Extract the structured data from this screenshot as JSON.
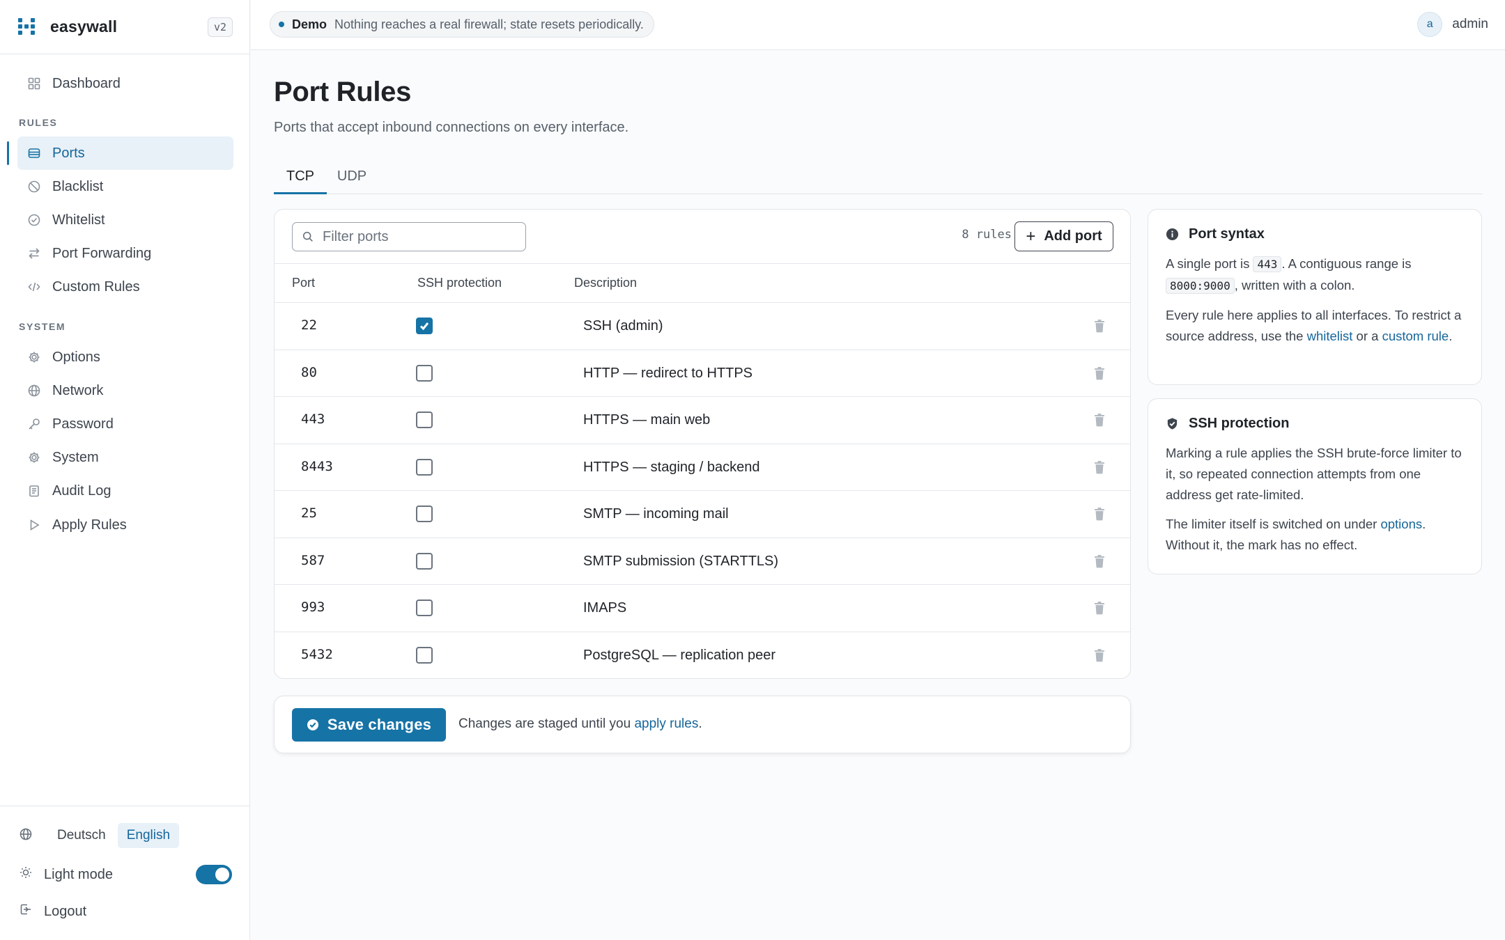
{
  "app": {
    "name": "easywall",
    "version": "v2"
  },
  "sidebar": {
    "dashboard": "Dashboard",
    "rules_label": "RULES",
    "rules": [
      {
        "label": "Ports",
        "icon": "ports-icon"
      },
      {
        "label": "Blacklist",
        "icon": "ban-icon"
      },
      {
        "label": "Whitelist",
        "icon": "check-circle-icon"
      },
      {
        "label": "Port Forwarding",
        "icon": "arrows-icon"
      },
      {
        "label": "Custom Rules",
        "icon": "code-icon"
      }
    ],
    "system_label": "SYSTEM",
    "system": [
      {
        "label": "Options",
        "icon": "gear-icon"
      },
      {
        "label": "Network",
        "icon": "globe-icon"
      },
      {
        "label": "Password",
        "icon": "key-icon"
      },
      {
        "label": "System",
        "icon": "gear-icon"
      },
      {
        "label": "Audit Log",
        "icon": "log-icon"
      },
      {
        "label": "Apply Rules",
        "icon": "play-icon"
      }
    ],
    "languages": [
      "Deutsch",
      "English"
    ],
    "selected_language": "English",
    "light_mode": "Light mode",
    "light_mode_on": true,
    "logout": "Logout"
  },
  "topbar": {
    "demo_label": "Demo",
    "demo_text": "Nothing reaches a real firewall; state resets periodically.",
    "avatar_letter": "a",
    "username": "admin"
  },
  "page": {
    "title": "Port Rules",
    "subtitle": "Ports that accept inbound connections on every interface.",
    "tabs": [
      "TCP",
      "UDP"
    ],
    "active_tab": "TCP"
  },
  "table": {
    "filter_placeholder": "Filter ports",
    "rule_count": "8 rules",
    "add_label": "Add port",
    "columns": [
      "Port",
      "SSH protection",
      "Description"
    ],
    "rows": [
      {
        "port": "22",
        "ssh": true,
        "description": "SSH (admin)"
      },
      {
        "port": "80",
        "ssh": false,
        "description": "HTTP — redirect to HTTPS"
      },
      {
        "port": "443",
        "ssh": false,
        "description": "HTTPS — main web"
      },
      {
        "port": "8443",
        "ssh": false,
        "description": "HTTPS — staging / backend"
      },
      {
        "port": "25",
        "ssh": false,
        "description": "SMTP — incoming mail"
      },
      {
        "port": "587",
        "ssh": false,
        "description": "SMTP submission (STARTTLS)"
      },
      {
        "port": "993",
        "ssh": false,
        "description": "IMAPS"
      },
      {
        "port": "5432",
        "ssh": false,
        "description": "PostgreSQL — replication peer"
      }
    ]
  },
  "save": {
    "button": "Save changes",
    "note_before": "Changes are staged until you",
    "note_link": "apply rules",
    "note_after": "."
  },
  "syntax_card": {
    "title": "Port syntax",
    "p1_a": "A single port is",
    "p1_code1": "443",
    "p1_b": ". A contiguous range is",
    "p1_code2": "8000:9000",
    "p1_c": ", written with a colon.",
    "p2_a": "Every rule here applies to all interfaces. To restrict a source address, use the",
    "p2_link1": "whitelist",
    "p2_b": "or a",
    "p2_link2": "custom rule",
    "p2_c": "."
  },
  "ssh_card": {
    "title": "SSH protection",
    "p1": "Marking a rule applies the SSH brute-force limiter to it, so repeated connection attempts from one address get rate-limited.",
    "p2_a": "The limiter itself is switched on under",
    "p2_link": "options",
    "p2_b": ". Without it, the mark has no effect."
  },
  "colors": {
    "accent": "#1673a6",
    "accent_bg": "#e8f1f8"
  }
}
